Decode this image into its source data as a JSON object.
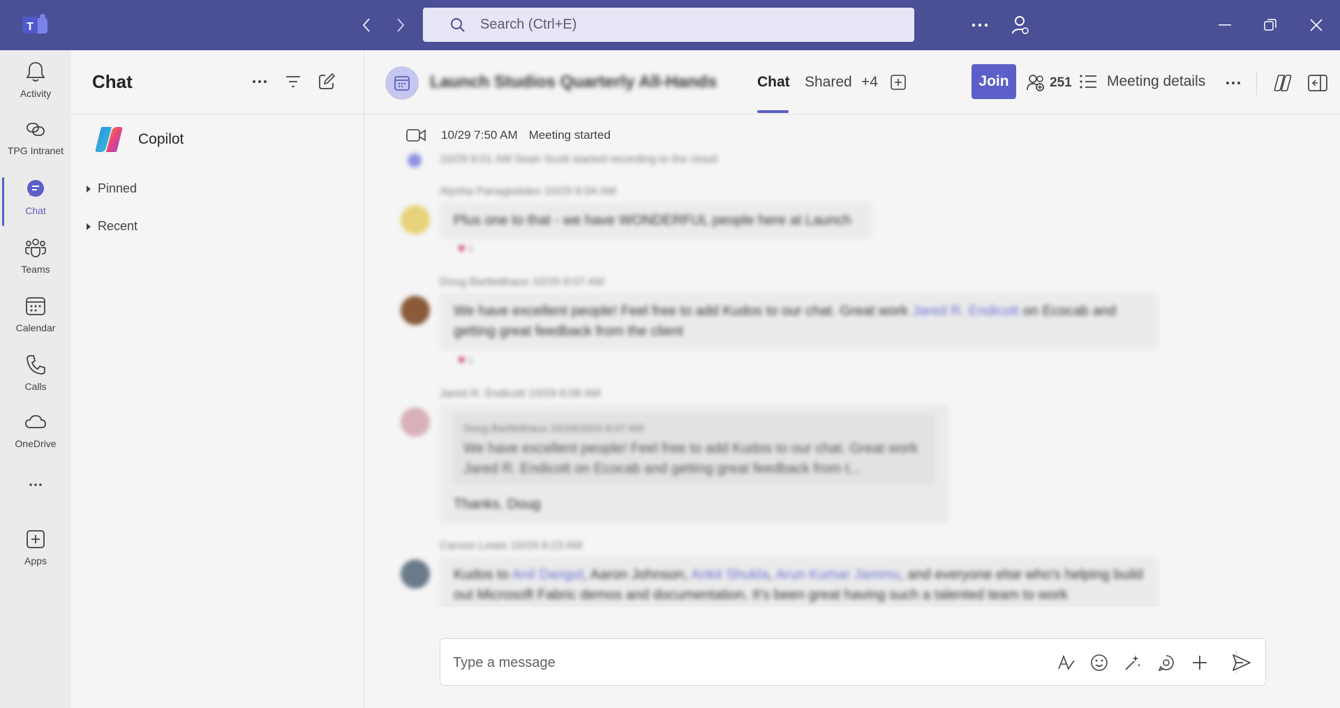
{
  "titlebar": {
    "search_placeholder": "Search (Ctrl+E)",
    "colors": {
      "bar": "#4b4f96",
      "search": "#e6e6f6"
    }
  },
  "rail": {
    "items": [
      {
        "label": "Activity",
        "icon": "bell-icon"
      },
      {
        "label": "TPG Intranet",
        "icon": "link-app-icon"
      },
      {
        "label": "Chat",
        "icon": "chat-icon",
        "active": true
      },
      {
        "label": "Teams",
        "icon": "teams-icon"
      },
      {
        "label": "Calendar",
        "icon": "calendar-icon"
      },
      {
        "label": "Calls",
        "icon": "phone-icon"
      },
      {
        "label": "OneDrive",
        "icon": "cloud-icon"
      },
      {
        "label": "Apps",
        "icon": "add-apps-icon"
      }
    ],
    "accent": "#5b5fc7"
  },
  "chat_list": {
    "title": "Chat",
    "copilot": "Copilot",
    "sections": [
      "Pinned",
      "Recent"
    ]
  },
  "meeting": {
    "title": "Launch Studios Quarterly All-Hands",
    "tabs": {
      "chat": "Chat",
      "shared": "Shared",
      "more": "+4"
    },
    "join_label": "Join",
    "participants_count": "251",
    "details_label": "Meeting details"
  },
  "feed": {
    "system_message": {
      "time": "10/29 7:50 AM",
      "text": "Meeting started"
    },
    "recording_notice": "10/29 8:01 AM  Sean Scott started recording to the cloud",
    "messages": [
      {
        "author_meta": "Alysha Panagiotides  10/29 8:04 AM",
        "text": "Plus one to that - we have WONDERFUL people here at Launch",
        "reactions": "1"
      },
      {
        "author_meta": "Doug Bartletthaus  10/29 8:07 AM",
        "text_before": "We have excellent people! Feel free to add Kudos to our chat.  Great work",
        "mention": "Jared R. Endicott",
        "text_after": "on Ecocab and getting great feedback from the client",
        "reactions": "1"
      },
      {
        "author_meta": "Jared R. Endicott  10/29 8:08 AM",
        "quote_meta": "Doug Bartletthaus  10/29/2024 8:07 AM",
        "quote_text": "We have excellent people! Feel free to add Kudos to our chat. Great work Jared R. Endicott on Ecocab and getting great feedback from t...",
        "text": "Thanks, Doug"
      },
      {
        "author_meta": "Carson Lewis  10/29 8:23 AM",
        "text_1": "Kudos to",
        "mention_1": "Anil Dangol",
        "text_2": ", Aaron Johnson,",
        "mention_2": "Ankit Shukla",
        "mention_3": "Arun Kumar Jammu",
        "text_3": ", and everyone else who's helping",
        "line_2": "build out Microsoft Fabric demos and documentation. It's been great having such a talented team to work"
      }
    ]
  },
  "composer": {
    "placeholder": "Type a message"
  }
}
